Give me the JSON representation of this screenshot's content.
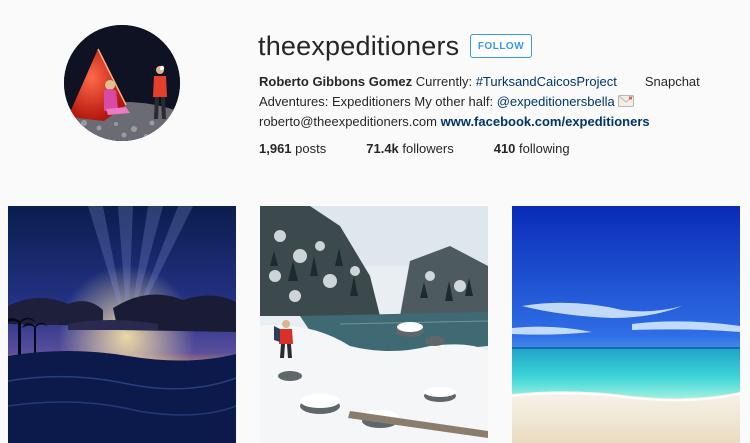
{
  "profile": {
    "username": "theexpeditioners",
    "follow_label": "FOLLOW",
    "bio": {
      "name": "Roberto Gibbons Gomez",
      "line1_text": " Currently: ",
      "hashtag": "#TurksandCaicosProject",
      "snapchat": "Snapchat",
      "line2_text": "Adventures: Expeditioners My other half: ",
      "mention": "@expeditionersbella",
      "email": "roberto@theexpeditioners.com",
      "website": "www.facebook.com/expeditioners"
    },
    "stats": [
      {
        "count": "1,961",
        "label": "posts"
      },
      {
        "count": "71.4k",
        "label": "followers"
      },
      {
        "count": "410",
        "label": "following"
      }
    ]
  },
  "posts": [
    {
      "subject": "tropical sunset over ocean with palm trees"
    },
    {
      "subject": "hiker by snowy mountain lake"
    },
    {
      "subject": "turquoise sea and white sand beach under blue sky"
    }
  ]
}
